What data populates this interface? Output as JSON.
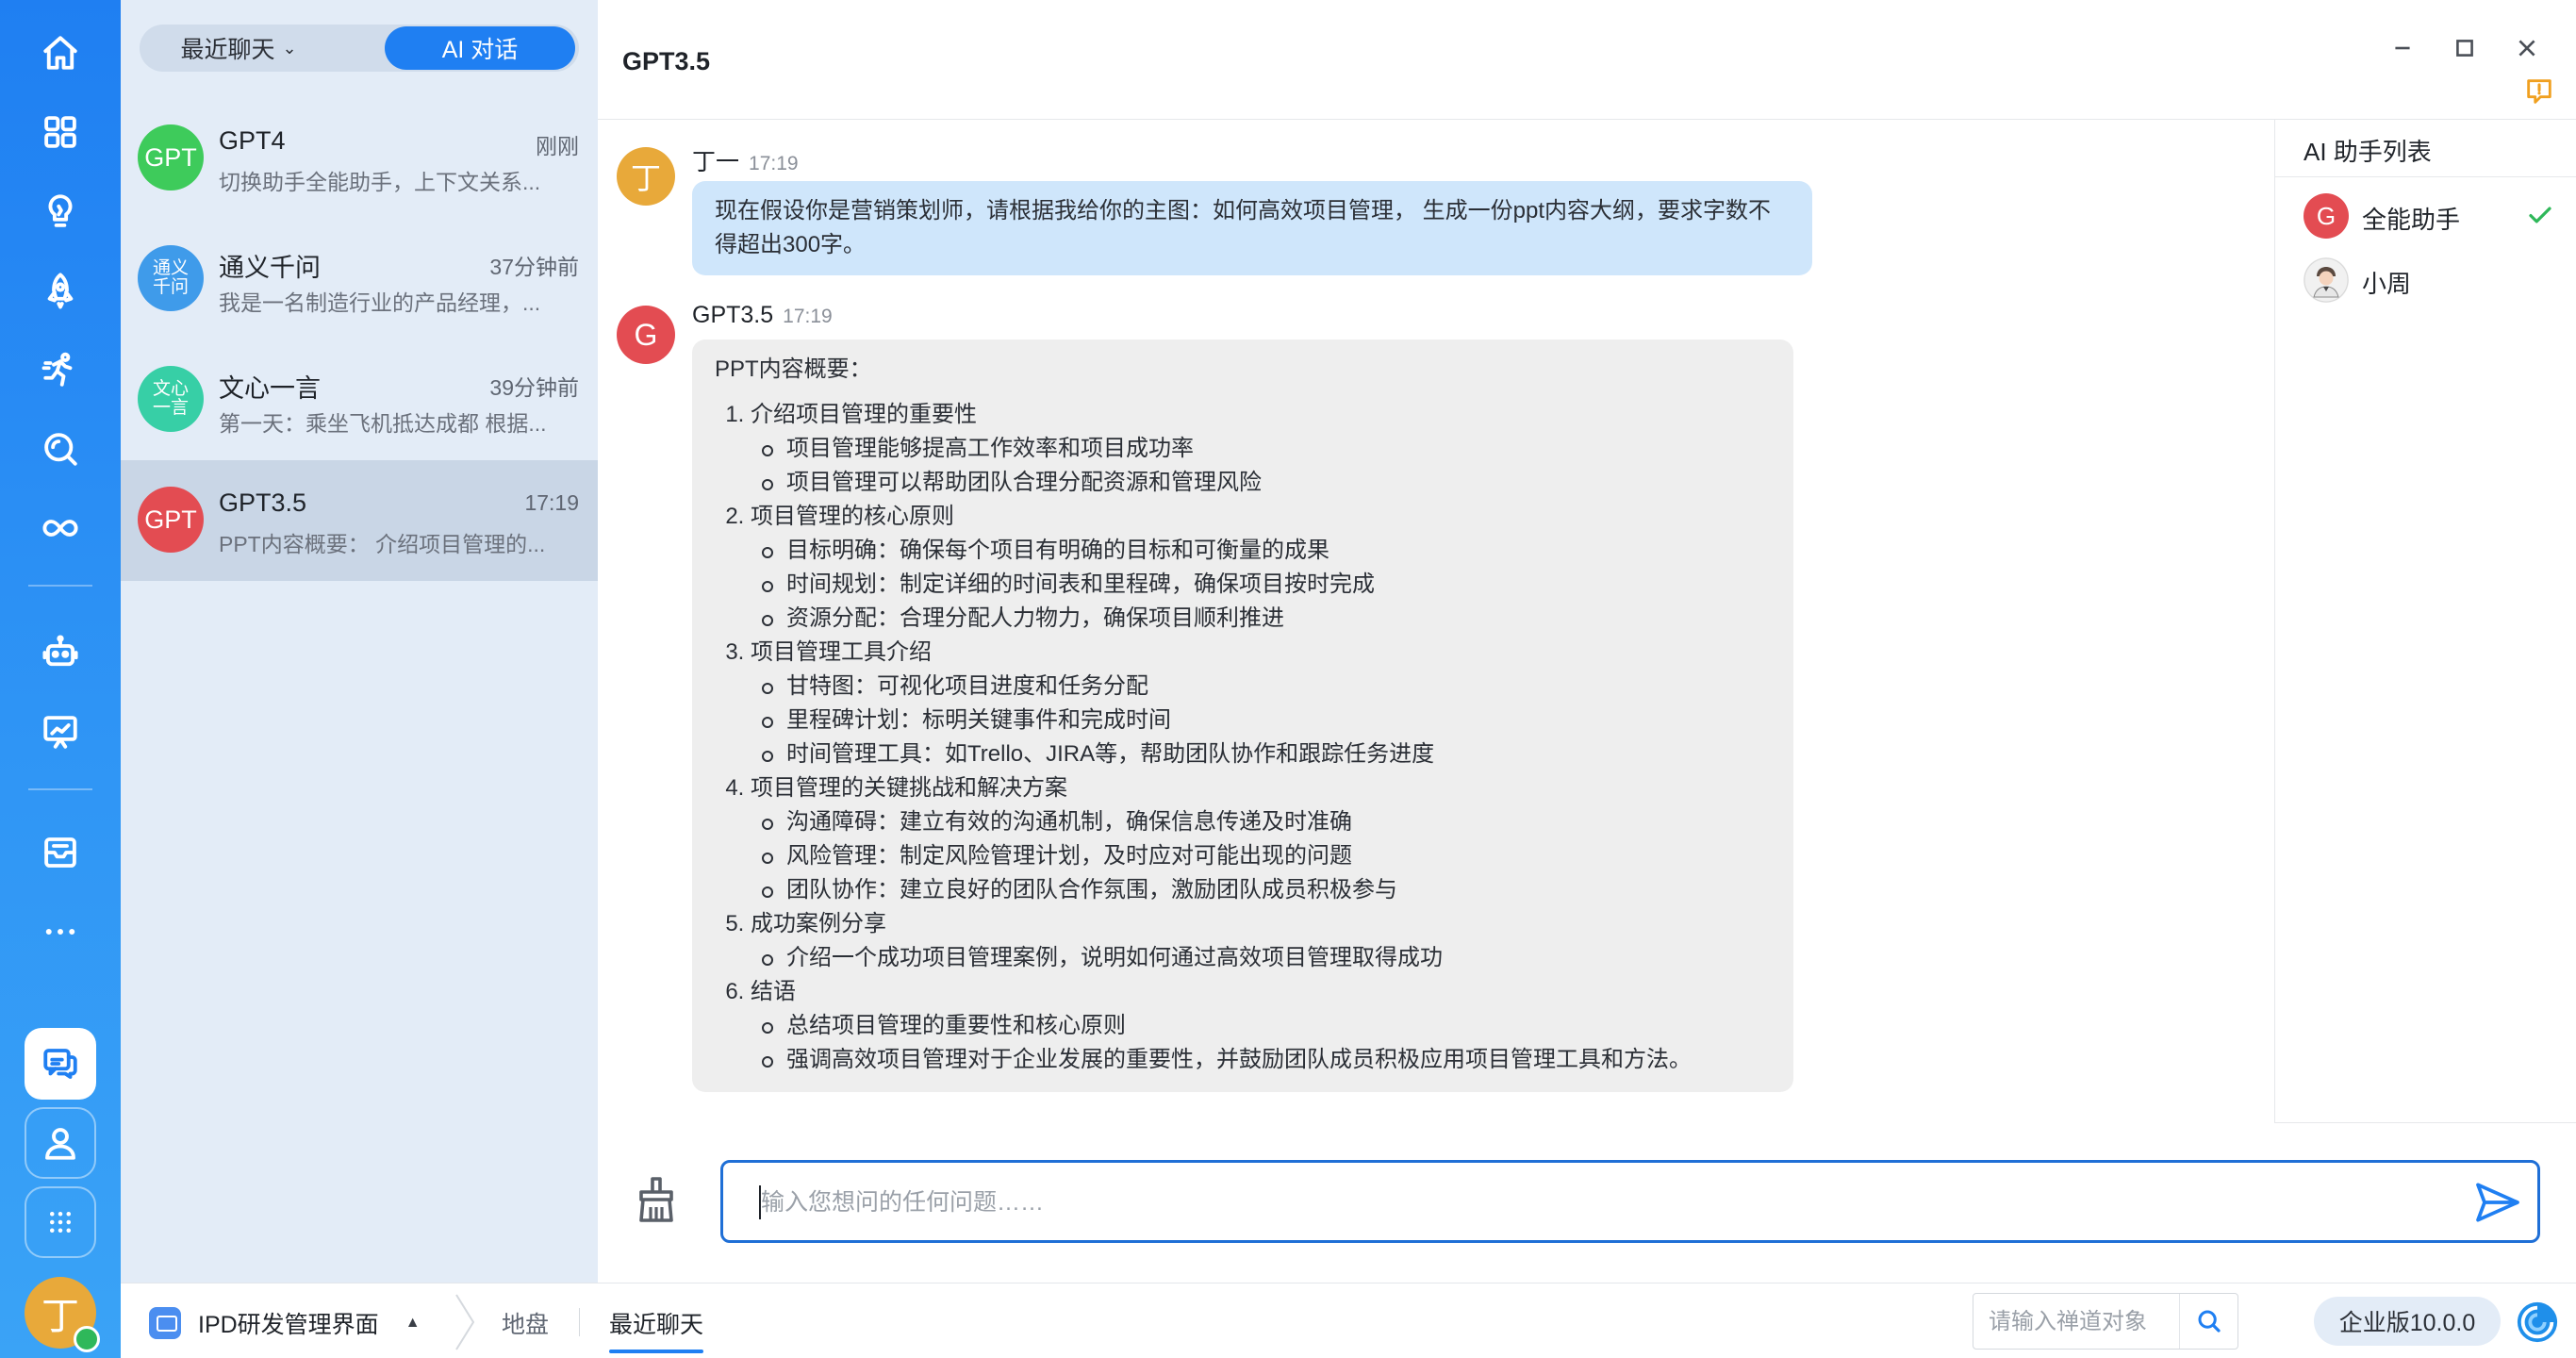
{
  "sidebar": {
    "icons": [
      "home-icon",
      "apps-grid-icon",
      "lightbulb-icon",
      "rocket-icon",
      "run-icon",
      "search-icon",
      "infinity-icon",
      "robot-icon",
      "chart-board-icon",
      "mail-icon",
      "more-icon",
      "chat-icon",
      "user-icon",
      "grid-dots-icon"
    ],
    "avatar_letter": "丁"
  },
  "list_panel": {
    "tab_recent": "最近聊天",
    "tab_ai": "AI 对话",
    "conversations": [
      {
        "avatar": "GPT",
        "avatar_color": "#3ecb5b",
        "name": "GPT4",
        "time": "刚刚",
        "preview": "切换助手全能助手，上下文关系..."
      },
      {
        "avatar": "通义千问",
        "avatar_color": "#3f9bea",
        "name": "通义千问",
        "time": "37分钟前",
        "preview": "我是一名制造行业的产品经理，..."
      },
      {
        "avatar": "文心一言",
        "avatar_color": "#37cfa6",
        "name": "文心一言",
        "time": "39分钟前",
        "preview": "第一天：乘坐飞机抵达成都 根据..."
      },
      {
        "avatar": "GPT",
        "avatar_color": "#e34c52",
        "name": "GPT3.5",
        "time": "17:19",
        "preview": "PPT内容概要：  介绍项目管理的..."
      }
    ]
  },
  "chat": {
    "title": "GPT3.5",
    "messages": [
      {
        "sender": "丁一",
        "avatar": "丁",
        "time": "17:19",
        "text": "现在假设你是营销策划师，请根据我给你的主图：如何高效项目管理，  生成一份ppt内容大纲，要求字数不得超出300字。"
      },
      {
        "sender": "GPT3.5",
        "avatar": "G",
        "time": "17:19",
        "heading": "PPT内容概要：",
        "sections": [
          {
            "title": "介绍项目管理的重要性",
            "points": [
              "项目管理能够提高工作效率和项目成功率",
              "项目管理可以帮助团队合理分配资源和管理风险"
            ]
          },
          {
            "title": "项目管理的核心原则",
            "points": [
              "目标明确：确保每个项目有明确的目标和可衡量的成果",
              "时间规划：制定详细的时间表和里程碑，确保项目按时完成",
              "资源分配：合理分配人力物力，确保项目顺利推进"
            ]
          },
          {
            "title": "项目管理工具介绍",
            "points": [
              "甘特图：可视化项目进度和任务分配",
              "里程碑计划：标明关键事件和完成时间",
              "时间管理工具：如Trello、JIRA等，帮助团队协作和跟踪任务进度"
            ]
          },
          {
            "title": "项目管理的关键挑战和解决方案",
            "points": [
              "沟通障碍：建立有效的沟通机制，确保信息传递及时准确",
              "风险管理：制定风险管理计划，及时应对可能出现的问题",
              "团队协作：建立良好的团队合作氛围，激励团队成员积极参与"
            ]
          },
          {
            "title": "成功案例分享",
            "points": [
              "介绍一个成功项目管理案例，说明如何通过高效项目管理取得成功"
            ]
          },
          {
            "title": "结语",
            "points": [
              "总结项目管理的重要性和核心原则",
              "强调高效项目管理对于企业发展的重要性，并鼓励团队成员积极应用项目管理工具和方法。"
            ]
          }
        ]
      }
    ],
    "input_placeholder": "输入您想问的任何问题……"
  },
  "assistants": {
    "title": "AI 助手列表",
    "items": [
      {
        "avatar": "G",
        "name": "全能助手",
        "selected": true
      },
      {
        "avatar": "face",
        "name": "小周",
        "selected": false
      }
    ]
  },
  "statusbar": {
    "app_name": "IPD研发管理界面",
    "tab_map": "地盘",
    "tab_recent": "最近聊天",
    "search_placeholder": "请输入禅道对象",
    "edition": "企业版10.0.0"
  },
  "colors": {
    "accent": "#1f7ff2",
    "user_bubble": "#cfe6fb",
    "bot_bubble": "#eeeeee",
    "rail": "#2a8cf3"
  }
}
